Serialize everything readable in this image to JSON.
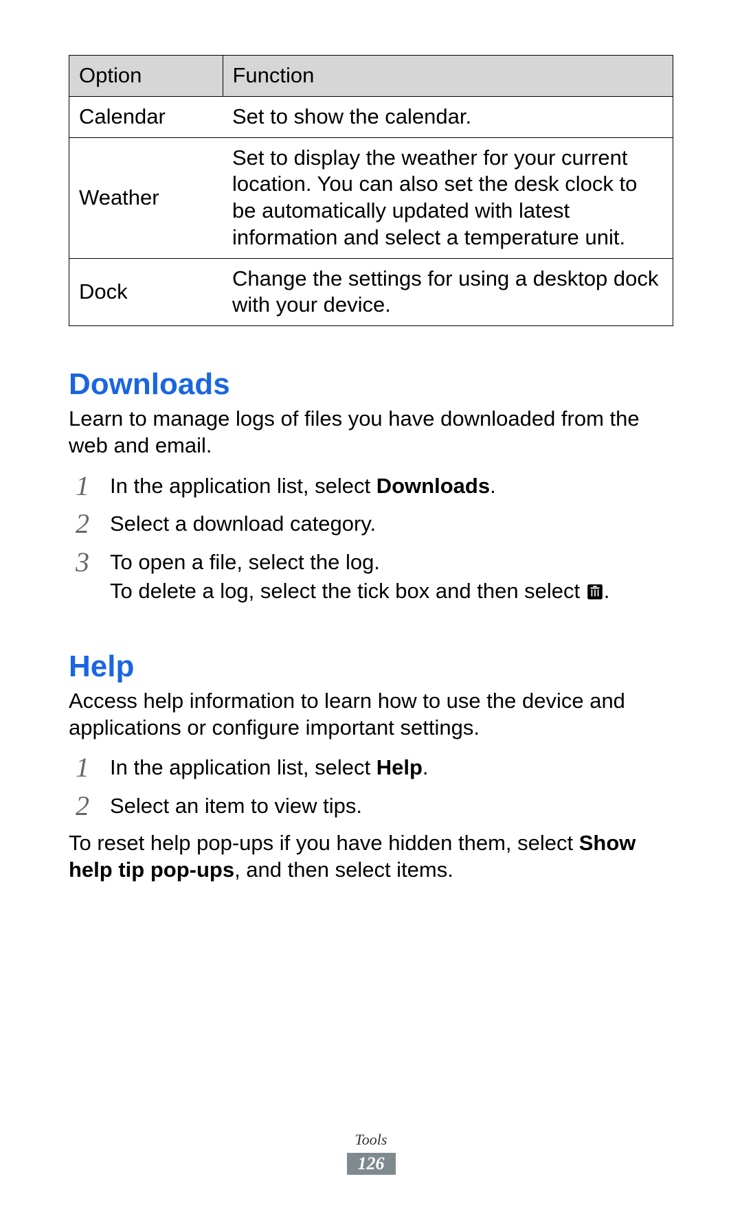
{
  "table": {
    "header": {
      "option": "Option",
      "function": "Function"
    },
    "rows": [
      {
        "option": "Calendar",
        "function": "Set to show the calendar."
      },
      {
        "option": "Weather",
        "function": "Set to display the weather for your current location. You can also set the desk clock to be automatically updated with latest information and select a temperature unit."
      },
      {
        "option": "Dock",
        "function": "Change the settings for using a desktop dock with your device."
      }
    ]
  },
  "downloads": {
    "heading": "Downloads",
    "intro": "Learn to manage logs of files you have downloaded from the web and email.",
    "step1_pre": "In the application list, select ",
    "step1_bold": "Downloads",
    "step1_post": ".",
    "step2": "Select a download category.",
    "step3_line1": "To open a file, select the log.",
    "step3_line2_pre": "To delete a log, select the tick box and then select ",
    "step3_line2_post": "."
  },
  "help": {
    "heading": "Help",
    "intro": "Access help information to learn how to use the device and applications or configure important settings.",
    "step1_pre": "In the application list, select ",
    "step1_bold": "Help",
    "step1_post": ".",
    "step2": "Select an item to view tips.",
    "closing_pre": "To reset help pop-ups if you have hidden them, select ",
    "closing_bold": "Show help tip pop-ups",
    "closing_post": ", and then select items."
  },
  "footer": {
    "section": "Tools",
    "page": "126"
  }
}
